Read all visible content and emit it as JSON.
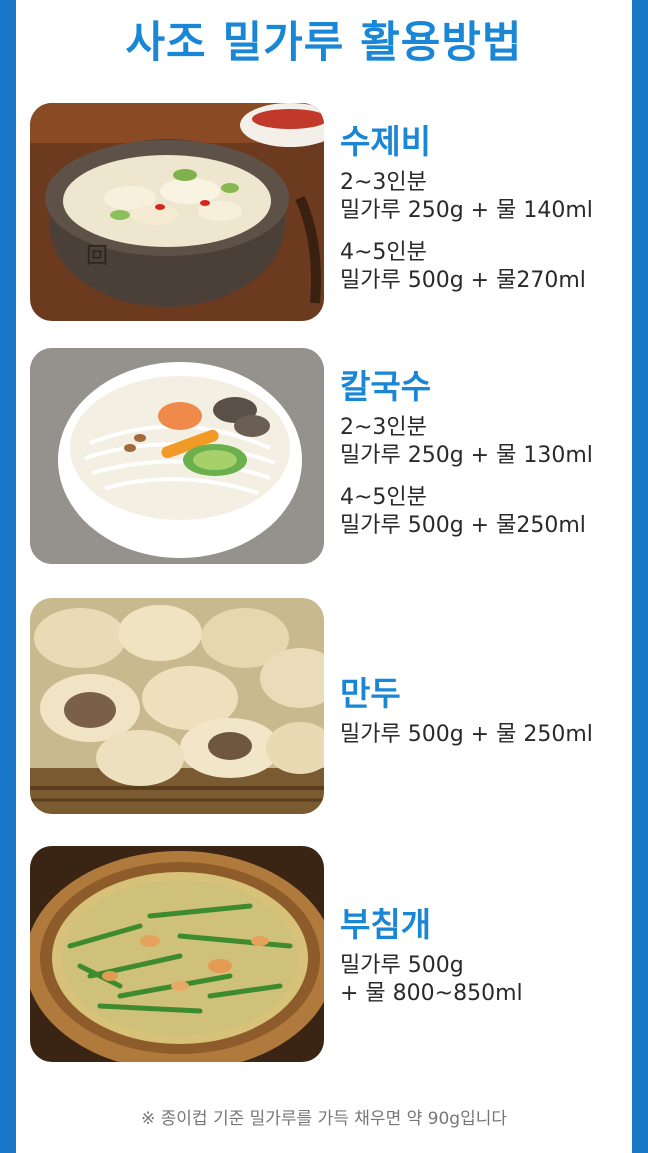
{
  "header": {
    "title": "사조 밀가루 활용방법"
  },
  "recipes": [
    {
      "name": "수제비",
      "image": "sujebi-photo",
      "lines": [
        "2~3인분",
        "밀가루 250g + 물 140ml",
        "4~5인분",
        "밀가루 500g + 물270ml"
      ]
    },
    {
      "name": "칼국수",
      "image": "kalguksu-photo",
      "lines": [
        "2~3인분",
        "밀가루 250g + 물 130ml",
        "4~5인분",
        "밀가루 500g + 물250ml"
      ]
    },
    {
      "name": "만두",
      "image": "mandu-photo",
      "lines": [
        "밀가루 500g + 물 250ml"
      ]
    },
    {
      "name": "부침개",
      "image": "buchimgae-photo",
      "lines": [
        "밀가루 500g",
        "+ 물 800~850ml"
      ]
    }
  ],
  "footer": {
    "note": "※ 종이컵 기준 밀가루를 가득 채우면 약 90g입니다"
  },
  "colors": {
    "accent": "#1a86d6",
    "frame": "#1a78c8"
  }
}
